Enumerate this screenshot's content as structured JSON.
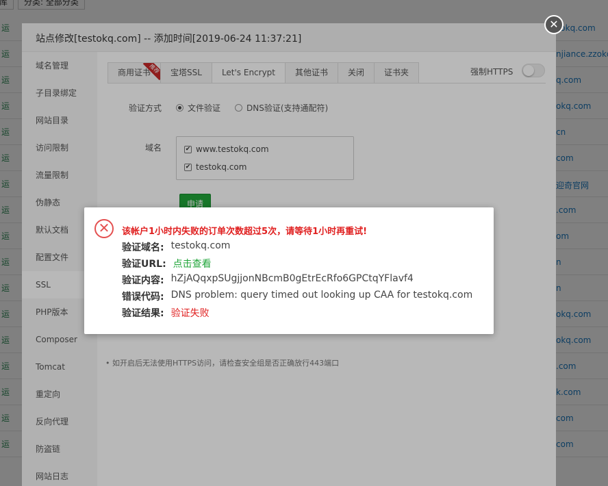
{
  "background": {
    "toolbar_left_label": "库",
    "category_filter": "分类: 全部分类",
    "row_mark": "运",
    "domains": [
      "zokq.com",
      "njiance.zzokq",
      "q.com",
      "okq.com",
      "cn",
      "com",
      "迎奇官网",
      ".com",
      "om",
      "n",
      "n",
      "okq.com",
      "okq.com",
      ".com",
      "k.com",
      "com",
      "com"
    ]
  },
  "modal": {
    "title": "站点修改[testokq.com] -- 添加时间[2019-06-24 11:37:21]",
    "close_glyph": "✕"
  },
  "sidebar": {
    "items": [
      {
        "label": "域名管理"
      },
      {
        "label": "子目录绑定"
      },
      {
        "label": "网站目录"
      },
      {
        "label": "访问限制"
      },
      {
        "label": "流量限制"
      },
      {
        "label": "伪静态"
      },
      {
        "label": "默认文档"
      },
      {
        "label": "配置文件"
      },
      {
        "label": "SSL"
      },
      {
        "label": "PHP版本"
      },
      {
        "label": "Composer"
      },
      {
        "label": "Tomcat"
      },
      {
        "label": "重定向"
      },
      {
        "label": "反向代理"
      },
      {
        "label": "防盗链"
      },
      {
        "label": "网站日志"
      }
    ],
    "active_index": 8
  },
  "ssl": {
    "tabs": [
      {
        "label": "商用证书"
      },
      {
        "label": "宝塔SSL"
      },
      {
        "label": "Let's Encrypt"
      },
      {
        "label": "其他证书"
      },
      {
        "label": "关闭"
      },
      {
        "label": "证书夹"
      }
    ],
    "active_tab": 2,
    "recommend_badge": "推荐",
    "force_https_label": "强制HTTPS",
    "verify_method_label": "验证方式",
    "verify_options": [
      "文件验证",
      "DNS验证(支持通配符)"
    ],
    "domain_label": "域名",
    "domains": [
      "www.testokq.com",
      "testokq.com"
    ],
    "check_glyph": "✔",
    "apply_label": "申请",
    "tip": "•  如开启后无法使用HTTPS访问，请检查安全组是否正确放行443端口"
  },
  "error": {
    "icon_glyph": "✕",
    "headline": "该帐户1小时内失败的订单次数超过5次，请等待1小时再重试!",
    "rows": [
      {
        "key": "验证域名:",
        "value": "testokq.com"
      },
      {
        "key": "验证URL:",
        "value": "点击查看"
      },
      {
        "key": "验证内容:",
        "value": "hZjAQqxpSUgjjonNBcmB0gEtrEcRfo6GPCtqYFlavf4"
      },
      {
        "key": "错误代码:",
        "value": "DNS problem: query timed out looking up CAA for testokq.com"
      },
      {
        "key": "验证结果:",
        "value": "验证失败"
      }
    ]
  }
}
